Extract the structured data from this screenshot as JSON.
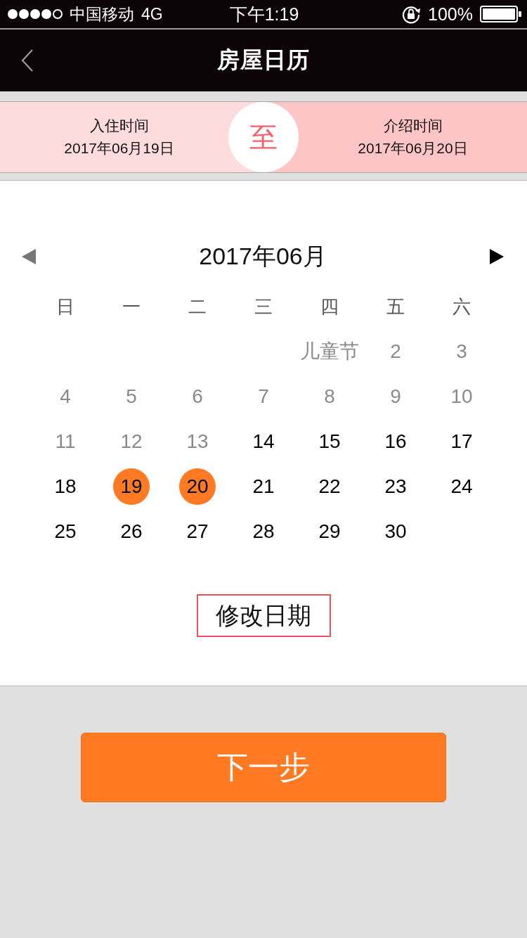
{
  "status_bar": {
    "carrier": "中国移动",
    "network": "4G",
    "time": "下午1:19",
    "battery": "100%"
  },
  "nav": {
    "title": "房屋日历"
  },
  "date_range": {
    "start": {
      "label": "入住时间",
      "date": "2017年06月19日"
    },
    "separator": "至",
    "end": {
      "label": "介绍时间",
      "date": "2017年06月20日"
    }
  },
  "calendar": {
    "month": "2017年06月",
    "prev": {
      "disabled": true
    },
    "next": {
      "disabled": false
    },
    "weekdays": [
      "日",
      "一",
      "二",
      "三",
      "四",
      "五",
      "六"
    ],
    "weeks": [
      [
        {
          "label": "儿童节",
          "disabled": true,
          "selected": false
        },
        {
          "label": "2",
          "disabled": true,
          "selected": false
        },
        {
          "label": "3",
          "disabled": true,
          "selected": false
        }
      ],
      [
        {
          "label": "4",
          "disabled": true,
          "selected": false
        },
        {
          "label": "5",
          "disabled": true,
          "selected": false
        },
        {
          "label": "6",
          "disabled": true,
          "selected": false
        },
        {
          "label": "7",
          "disabled": true,
          "selected": false
        },
        {
          "label": "8",
          "disabled": true,
          "selected": false
        },
        {
          "label": "9",
          "disabled": true,
          "selected": false
        },
        {
          "label": "10",
          "disabled": true,
          "selected": false
        }
      ],
      [
        {
          "label": "11",
          "disabled": true,
          "selected": false
        },
        {
          "label": "12",
          "disabled": true,
          "selected": false
        },
        {
          "label": "13",
          "disabled": true,
          "selected": false
        },
        {
          "label": "14",
          "disabled": false,
          "selected": false
        },
        {
          "label": "15",
          "disabled": false,
          "selected": false
        },
        {
          "label": "16",
          "disabled": false,
          "selected": false
        },
        {
          "label": "17",
          "disabled": false,
          "selected": false
        }
      ],
      [
        {
          "label": "18",
          "disabled": false,
          "selected": false
        },
        {
          "label": "19",
          "disabled": false,
          "selected": true
        },
        {
          "label": "20",
          "disabled": false,
          "selected": true
        },
        {
          "label": "21",
          "disabled": false,
          "selected": false
        },
        {
          "label": "22",
          "disabled": false,
          "selected": false
        },
        {
          "label": "23",
          "disabled": false,
          "selected": false
        },
        {
          "label": "24",
          "disabled": false,
          "selected": false
        }
      ],
      [
        {
          "label": "25",
          "disabled": false,
          "selected": false
        },
        {
          "label": "26",
          "disabled": false,
          "selected": false
        },
        {
          "label": "27",
          "disabled": false,
          "selected": false
        },
        {
          "label": "28",
          "disabled": false,
          "selected": false
        },
        {
          "label": "29",
          "disabled": false,
          "selected": false
        },
        {
          "label": "30",
          "disabled": false,
          "selected": false
        }
      ]
    ]
  },
  "edit_button": "修改日期",
  "next_button": "下一步"
}
